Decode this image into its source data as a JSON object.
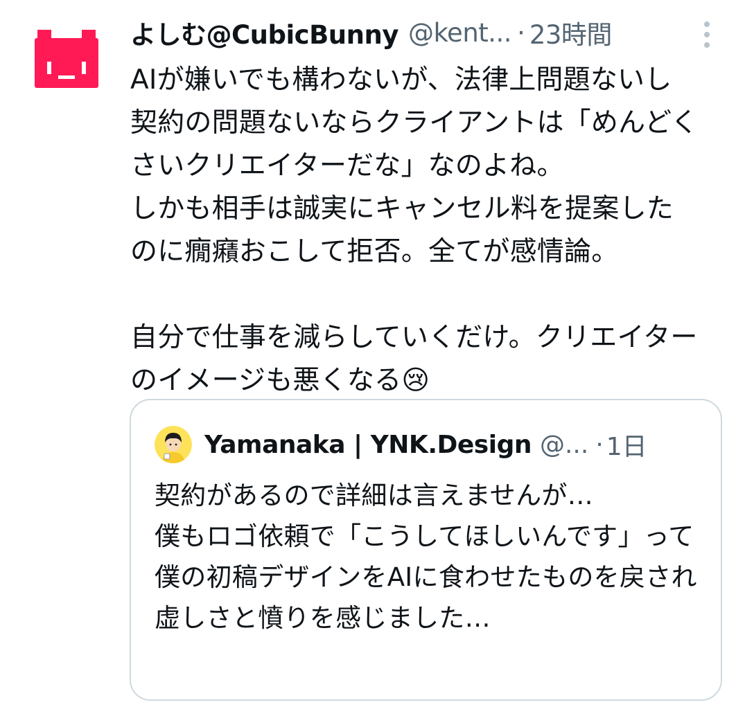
{
  "tweet": {
    "display_name": "よしむ@CubicBunny",
    "handle": "@kent...",
    "separator": "·",
    "timestamp": "23時間",
    "text": "AIが嫌いでも構わないが、法律上問題ないし契約の問題ないならクライアントは「めんどくさいクリエイターだな」なのよね。\nしかも相手は誠実にキャンセル料を提案したのに癇癪おこして拒否。全てが感情論。\n\n自分で仕事を減らしていくだけ。クリエイターのイメージも悪くなる😢",
    "avatar_icon": "cubic-bunny-avatar-icon",
    "more_icon": "more-vertical-icon",
    "brand_color": "#ff1a55"
  },
  "quote": {
    "display_name": "Yamanaka | YNK.Design",
    "handle": "@...",
    "separator": "·",
    "timestamp": "1日",
    "avatar_icon": "cartoon-person-avatar-icon",
    "text": "契約があるので詳細は言えませんが…\n僕もロゴ依頼で「こうしてほしいんです」って僕の初稿デザインをAIに食わせたものを戻され虚しさと憤りを感じました…"
  }
}
